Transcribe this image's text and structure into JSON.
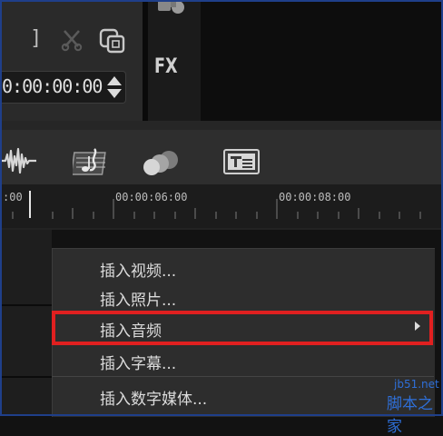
{
  "app": {
    "bracket": "]",
    "timecode": "0:00:00:00",
    "fx_label": "FX"
  },
  "timeline": {
    "ruler_labels": [
      ":00",
      "00:00:06:00",
      "00:00:08:00"
    ]
  },
  "context_menu": {
    "items": [
      {
        "label": "插入视频..."
      },
      {
        "label": "插入照片..."
      },
      {
        "label": "插入音频",
        "has_submenu": true
      },
      {
        "label": "插入字幕..."
      },
      {
        "label": "插入数字媒体..."
      }
    ]
  },
  "watermark": {
    "line1": "jb51.net",
    "line2": "脚本之家"
  },
  "colors": {
    "highlight": "#e02020",
    "frame": "#1f3f8a",
    "watermark": "#2e6fd8"
  }
}
